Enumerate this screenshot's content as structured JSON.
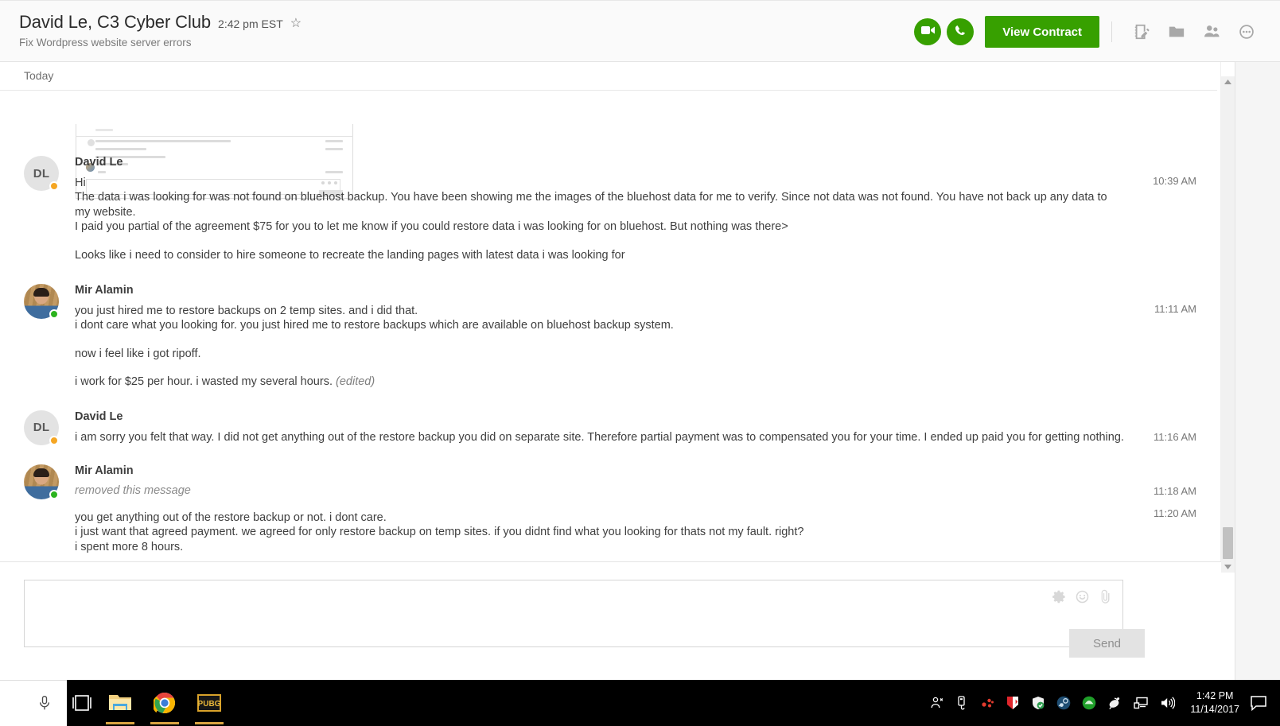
{
  "header": {
    "title": "David Le, C3 Cyber Club",
    "time": "2:42 pm EST",
    "subtitle": "Fix Wordpress website server errors",
    "star_icon": "star-icon",
    "video_icon": "video-camera-icon",
    "phone_icon": "phone-icon",
    "view_contract_label": "View Contract",
    "notes_icon": "notepad-pen-icon",
    "folder_icon": "folder-icon",
    "people_icon": "people-icon",
    "more_icon": "more-options-icon",
    "accent_green": "#37a000"
  },
  "date_divider": {
    "label": "Today"
  },
  "messages": [
    {
      "author": "David Le",
      "avatar_type": "initials",
      "initials": "DL",
      "status": "away",
      "status_color": "#f5a623",
      "time": "10:39 AM",
      "paragraphs": [
        [
          "Hi",
          "The data i was looking for was not found on bluehost backup. You have been showing me the images of the bluehost data for me to verify. Since not data was not found. You have not back up any data to my website.",
          "I paid you partial of the agreement $75 for you to let me know if you could restore data i was looking for on bluehost. But nothing was there>"
        ],
        [
          "Looks like i need to consider to hire someone to recreate the landing pages with latest data i was looking for"
        ]
      ]
    },
    {
      "author": "Mir Alamin",
      "avatar_type": "photo",
      "initials": "MA",
      "status": "online",
      "status_color": "#2bb31e",
      "time": "11:11 AM",
      "paragraphs": [
        [
          "you just hired me to restore backups on 2 temp sites. and i did that.",
          "i dont care what you looking for. you just hired me to restore backups which are available on bluehost backup system."
        ],
        [
          "now i feel like i got ripoff."
        ],
        [
          "i work for $25 per hour. i wasted my several hours."
        ]
      ],
      "edited_label": "(edited)"
    },
    {
      "author": "David Le",
      "avatar_type": "initials",
      "initials": "DL",
      "status": "away",
      "status_color": "#f5a623",
      "time": "11:16 AM",
      "paragraphs": [
        [
          "i am sorry you felt that way. I did not get anything out of the restore backup you did on separate site. Therefore partial payment was to compensated you for your time. I ended up paid you for getting nothing."
        ]
      ]
    },
    {
      "author": "Mir Alamin",
      "avatar_type": "photo",
      "initials": "MA",
      "status": "online",
      "status_color": "#2bb31e",
      "removed_label": "removed this message",
      "removed_time": "11:18 AM",
      "time": "11:20 AM",
      "paragraphs": [
        [
          "you get anything out of the restore backup or not. i dont care.",
          "i just want that agreed payment. we agreed for only restore backup on temp sites. if you didnt find what you looking for thats not my fault. right?",
          "i spent more 8 hours."
        ]
      ]
    }
  ],
  "composer": {
    "value": "",
    "placeholder": "",
    "settings_icon": "gear-icon",
    "emoji_icon": "emoji-smiley-icon",
    "attach_icon": "paperclip-icon",
    "send_label": "Send"
  },
  "taskbar": {
    "mic_icon": "microphone-icon",
    "task_view_icon": "task-view-icon",
    "apps": [
      {
        "name": "file-explorer",
        "label": "File Explorer"
      },
      {
        "name": "google-chrome",
        "label": "Google Chrome"
      },
      {
        "name": "pubg",
        "label": "PUBG"
      }
    ],
    "tray": [
      "show-hidden-icons-people-icon",
      "usb-eject-icon",
      "molecule-icon",
      "kaspersky-icon",
      "windows-defender-icon",
      "steam-icon",
      "green-circle-icon",
      "satellite-dish-icon",
      "network-icon",
      "volume-icon"
    ],
    "clock_time": "1:42 PM",
    "clock_date": "11/14/2017",
    "notification_icon": "action-center-icon"
  }
}
